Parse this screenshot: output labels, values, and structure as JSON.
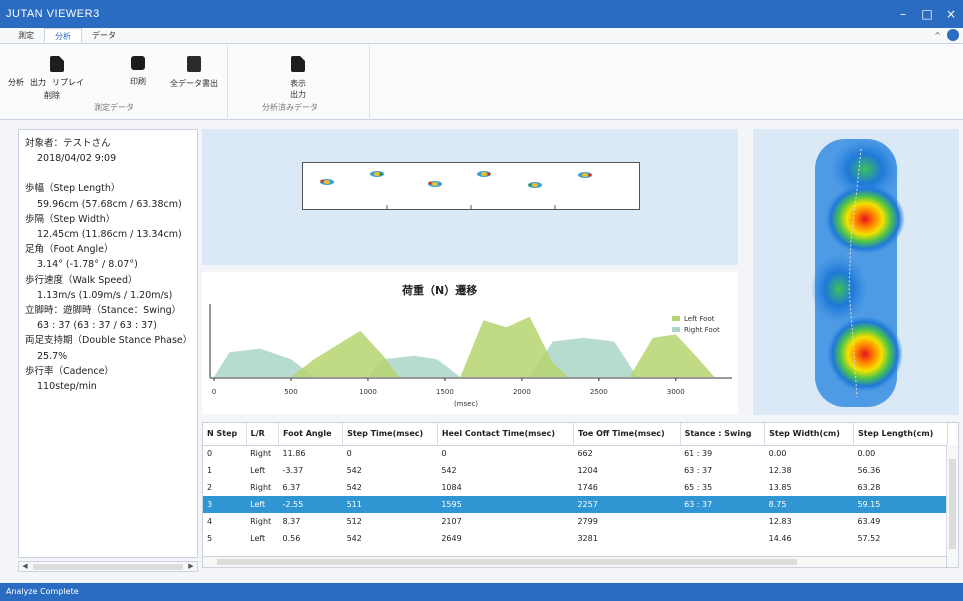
{
  "window": {
    "title": "JUTAN VIEWER3",
    "controls": [
      "–",
      "□",
      "×"
    ]
  },
  "tabs": [
    {
      "label": "測定",
      "active": false
    },
    {
      "label": "分析",
      "active": true
    },
    {
      "label": "データ",
      "active": false
    }
  ],
  "ribbon": {
    "left_labels": {
      "analyze": "分析",
      "output": "出力",
      "replay": "リプレイ",
      "delete": "削除"
    },
    "print_label": "印刷",
    "export_label": "全データ書出",
    "group1_caption": "測定データ",
    "display_label": "表示",
    "output2_label": "出力",
    "group2_caption": "分析済みデータ"
  },
  "info": {
    "subject": "対象者：テストさん",
    "datetime": "2018/04/02 9:09",
    "step_length_label": "歩幅（Step Length）",
    "step_length_value": "59.96cm (57.68cm / 63.38cm)",
    "step_width_label": "歩隔（Step Width）",
    "step_width_value": "12.45cm (11.86cm / 13.34cm)",
    "foot_angle_label": "足角（Foot Angle）",
    "foot_angle_value": "3.14° (-1.78° / 8.07°)",
    "walk_speed_label": "歩行速度（Walk Speed）",
    "walk_speed_value": "1.13m/s (1.09m/s / 1.20m/s)",
    "stance_swing_label": "立脚時：遊脚時（Stance：Swing）",
    "stance_swing_value": "63 : 37 (63 : 37 / 63 : 37)",
    "double_stance_label": "両足支持期（Double Stance Phase）",
    "double_stance_value": "25.7%",
    "cadence_label": "歩行率（Cadence）",
    "cadence_value": "110step/min"
  },
  "chart_data": {
    "type": "area",
    "title": "荷重（N）遷移",
    "xlabel": "(msec)",
    "ylabel": "",
    "xlim": [
      0,
      3300
    ],
    "x_ticks": [
      0,
      500,
      1000,
      1500,
      2000,
      2500,
      3000
    ],
    "legend_position": "right",
    "series": [
      {
        "name": "Left Foot",
        "color": "#b6d36e",
        "points": [
          [
            500,
            0
          ],
          [
            650,
            25
          ],
          [
            800,
            45
          ],
          [
            950,
            65
          ],
          [
            1100,
            30
          ],
          [
            1200,
            0
          ],
          [
            1600,
            0
          ],
          [
            1750,
            80
          ],
          [
            1900,
            70
          ],
          [
            2050,
            85
          ],
          [
            2200,
            20
          ],
          [
            2300,
            0
          ],
          [
            2700,
            0
          ],
          [
            2850,
            55
          ],
          [
            3000,
            60
          ],
          [
            3150,
            25
          ],
          [
            3250,
            0
          ]
        ]
      },
      {
        "name": "Right Foot",
        "color": "#a9d6c8",
        "points": [
          [
            0,
            0
          ],
          [
            100,
            35
          ],
          [
            300,
            40
          ],
          [
            500,
            25
          ],
          [
            650,
            0
          ],
          [
            1000,
            0
          ],
          [
            1100,
            25
          ],
          [
            1300,
            30
          ],
          [
            1450,
            25
          ],
          [
            1600,
            0
          ],
          [
            2050,
            0
          ],
          [
            2200,
            50
          ],
          [
            2400,
            55
          ],
          [
            2600,
            50
          ],
          [
            2750,
            0
          ]
        ]
      }
    ]
  },
  "table": {
    "columns": [
      "N Step",
      "L/R",
      "Foot Angle",
      "Step Time(msec)",
      "Heel Contact Time(msec)",
      "Toe Off Time(msec)",
      "Stance : Swing",
      "Step Width(cm)",
      "Step Length(cm)"
    ],
    "rows": [
      [
        "0",
        "Right",
        "11.86",
        "0",
        "0",
        "662",
        "61 : 39",
        "0.00",
        "0.00"
      ],
      [
        "1",
        "Left",
        "-3.37",
        "542",
        "542",
        "1204",
        "63 : 37",
        "12.38",
        "56.36"
      ],
      [
        "2",
        "Right",
        "6.37",
        "542",
        "1084",
        "1746",
        "65 : 35",
        "13.85",
        "63.28"
      ],
      [
        "3",
        "Left",
        "-2.55",
        "511",
        "1595",
        "2257",
        "63 : 37",
        "8.75",
        "59.15"
      ],
      [
        "4",
        "Right",
        "8.37",
        "512",
        "2107",
        "2799",
        "",
        "12.83",
        "63.49"
      ],
      [
        "5",
        "Left",
        "0.56",
        "542",
        "2649",
        "3281",
        "",
        "14.46",
        "57.52"
      ]
    ],
    "selected_row": 3
  },
  "status": {
    "text": "Analyze Complete"
  }
}
